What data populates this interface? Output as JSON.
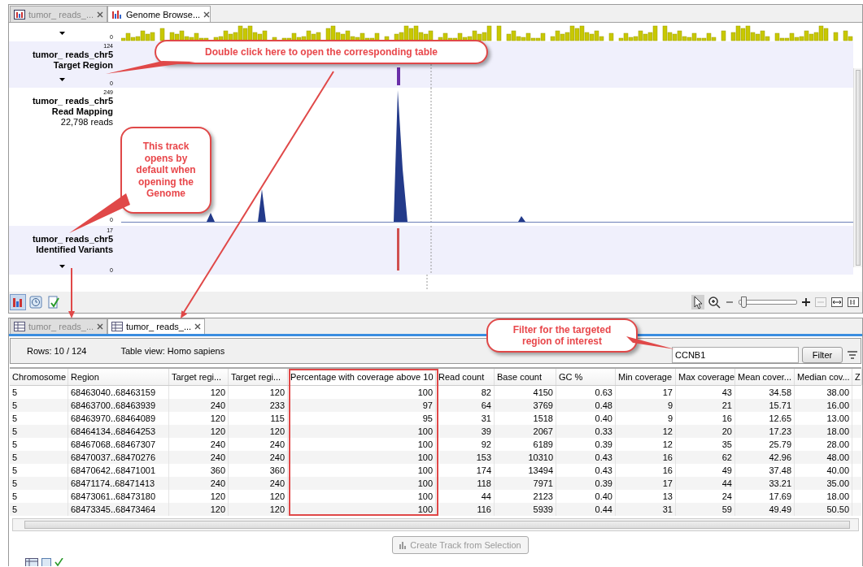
{
  "top_tabs": [
    {
      "label": "tumor_ reads_...",
      "selected": false
    },
    {
      "label": "Genome Browse...",
      "selected": true
    }
  ],
  "tracks": [
    {
      "kind": "coverage",
      "axis_min": "0"
    },
    {
      "kind": "region",
      "axis_max": "124",
      "name": "tumor_ reads_chr5",
      "subtitle": "Target Region",
      "axis_min": "0"
    },
    {
      "kind": "mapping",
      "axis_max": "249",
      "name": "tumor_ reads_chr5",
      "subtitle": "Read Mapping",
      "info": "22,798 reads",
      "axis_min": "0"
    },
    {
      "kind": "variants",
      "axis_max": "17",
      "name": "tumor_ reads_chr5",
      "subtitle": "Identified Variants",
      "axis_min": "0"
    }
  ],
  "zoom_slider": {
    "level": 0.03
  },
  "bottom_tabs": [
    {
      "label": "tumor_ reads_...",
      "selected": false
    },
    {
      "label": "tumor_ reads_...",
      "selected": true
    }
  ],
  "table_info": {
    "rows": "Rows: 10 / 124",
    "view": "Table view: Homo sapiens"
  },
  "filter": {
    "value": "CCNB1",
    "button": "Filter"
  },
  "table": {
    "columns": [
      {
        "label": "Chromosome",
        "highlighted": false
      },
      {
        "label": "Region",
        "highlighted": false
      },
      {
        "label": "Target regi...",
        "highlighted": false
      },
      {
        "label": "Target regi...",
        "highlighted": false
      },
      {
        "label": "Percentage with coverage above 10",
        "highlighted": true
      },
      {
        "label": "Read count",
        "highlighted": false
      },
      {
        "label": "Base count",
        "highlighted": false
      },
      {
        "label": "GC %",
        "highlighted": false
      },
      {
        "label": "Min coverage",
        "highlighted": false
      },
      {
        "label": "Max coverage",
        "highlighted": false
      },
      {
        "label": "Mean cover...",
        "highlighted": false
      },
      {
        "label": "Median cov...",
        "highlighted": false
      },
      {
        "label": "Z",
        "highlighted": false
      }
    ],
    "rows": [
      [
        "5",
        "68463040..68463159",
        "120",
        "120",
        "100",
        "82",
        "4150",
        "0.63",
        "17",
        "43",
        "34.58",
        "38.00"
      ],
      [
        "5",
        "68463700..68463939",
        "240",
        "233",
        "97",
        "64",
        "3769",
        "0.48",
        "9",
        "21",
        "15.71",
        "16.00"
      ],
      [
        "5",
        "68463970..68464089",
        "120",
        "115",
        "95",
        "31",
        "1518",
        "0.40",
        "9",
        "16",
        "12.65",
        "13.00"
      ],
      [
        "5",
        "68464134..68464253",
        "120",
        "120",
        "100",
        "39",
        "2067",
        "0.33",
        "12",
        "20",
        "17.23",
        "18.00"
      ],
      [
        "5",
        "68467068..68467307",
        "240",
        "240",
        "100",
        "92",
        "6189",
        "0.39",
        "12",
        "35",
        "25.79",
        "28.00"
      ],
      [
        "5",
        "68470037..68470276",
        "240",
        "240",
        "100",
        "153",
        "10310",
        "0.43",
        "16",
        "62",
        "42.96",
        "48.00"
      ],
      [
        "5",
        "68470642..68471001",
        "360",
        "360",
        "100",
        "174",
        "13494",
        "0.43",
        "16",
        "49",
        "37.48",
        "40.00"
      ],
      [
        "5",
        "68471174..68471413",
        "240",
        "240",
        "100",
        "118",
        "7971",
        "0.39",
        "17",
        "44",
        "33.21",
        "35.00"
      ],
      [
        "5",
        "68473061..68473180",
        "120",
        "120",
        "100",
        "44",
        "2123",
        "0.40",
        "13",
        "24",
        "17.69",
        "18.00"
      ],
      [
        "5",
        "68473345..68473464",
        "120",
        "120",
        "100",
        "116",
        "5939",
        "0.44",
        "31",
        "59",
        "49.49",
        "50.50"
      ]
    ]
  },
  "create_button": {
    "label": "Create Track from Selection",
    "disabled": true
  },
  "callouts": [
    {
      "text": "Double click here to open the corresponding table"
    },
    {
      "text": "This track opens by default when opening the Genome"
    },
    {
      "text": "Filter for the targeted region of interest"
    }
  ]
}
